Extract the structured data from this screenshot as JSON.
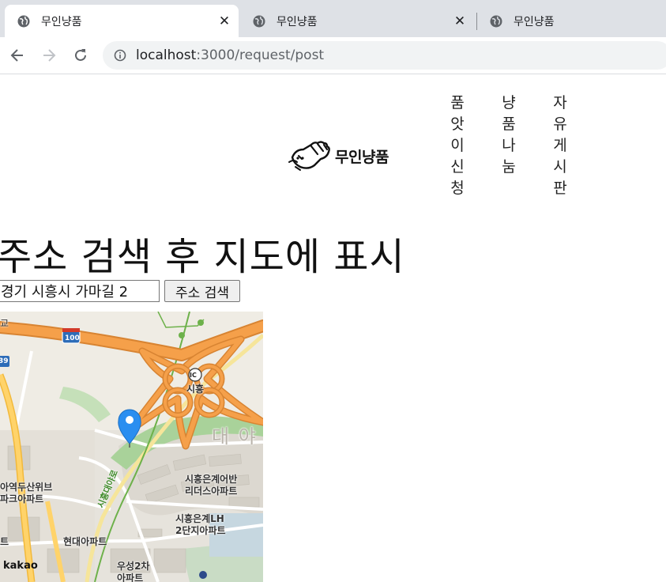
{
  "browser": {
    "tabs": [
      {
        "title": "무인냥품",
        "active": true
      },
      {
        "title": "무인냥품",
        "active": false
      },
      {
        "title": "무인냥품",
        "active": false
      }
    ],
    "url_host": "localhost",
    "url_path": ":3000/request/post"
  },
  "header": {
    "logo_text": "무인냥품",
    "menu": [
      "품앗이신청",
      "냥품나눔",
      "자유게시판"
    ]
  },
  "main": {
    "title": "주소 검색 후 지도에 표시",
    "address_value": "경기 시흥시 가마길 2",
    "search_label": "주소 검색"
  },
  "map": {
    "labels": {
      "ic_badge": "IC",
      "ic_name": "시흥",
      "highway": "100",
      "route": "39",
      "area_big": "대 야",
      "road": "시흥대야로",
      "apt1_line1": "시흥은계어반",
      "apt1_line2": "리더스아파트",
      "apt2_line1": "시흥은계LH",
      "apt2_line2": "2단지아파트",
      "apt3_line1": "아역두산위브",
      "apt3_line2": "파크아파트",
      "apt4": "현대아파트",
      "apt5_line1": "우성2차",
      "apt5_line2": "아파트",
      "edge_left": "트",
      "edge_top": "교",
      "brand": "kakao"
    },
    "colors": {
      "highway": "#f5a04a",
      "highway_edge": "#d88432",
      "main_road": "#ffd36a",
      "green": "#a9d29a",
      "marker": "#2a8ef0"
    }
  }
}
